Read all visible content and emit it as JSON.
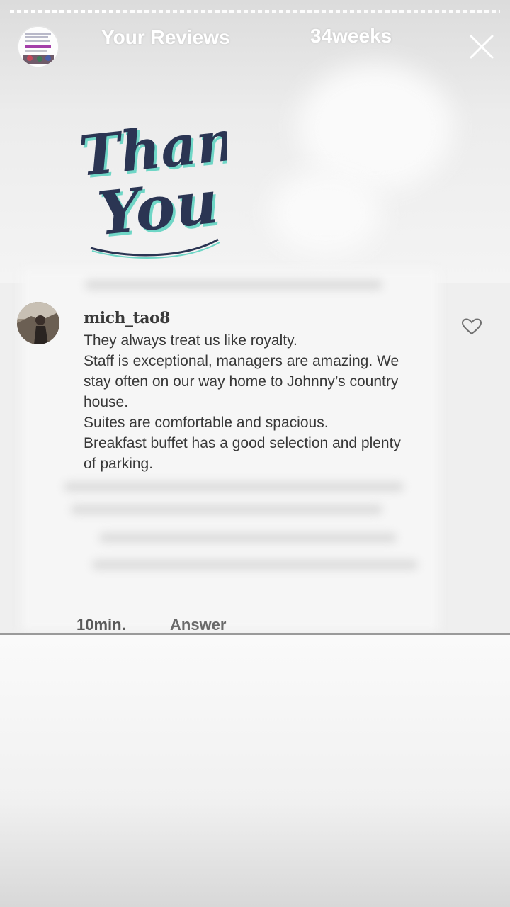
{
  "header": {
    "title": "Your Reviews",
    "time_ago": "34weeks",
    "story_progress": 0.23
  },
  "hero": {
    "image": "thank-you-lettering",
    "text_line1": "Thank",
    "text_line2": "You"
  },
  "comment": {
    "username": "mich_tao8",
    "text": "They always treat us like royalty.\nStaff is exceptional, managers are amazing. We stay often on our way home to Johnny’s country house.\nSuites are comfortable and spacious.\nBreakfast buffet has a good selection and plenty of parking.",
    "time": "10min.",
    "answer_label": "Answer"
  },
  "icons": {
    "close": "close-icon",
    "like": "heart-icon"
  },
  "colors": {
    "lettering_dark": "#2b3553",
    "lettering_accent": "#6fd6c6",
    "text": "#383838",
    "white": "#ffffff"
  }
}
